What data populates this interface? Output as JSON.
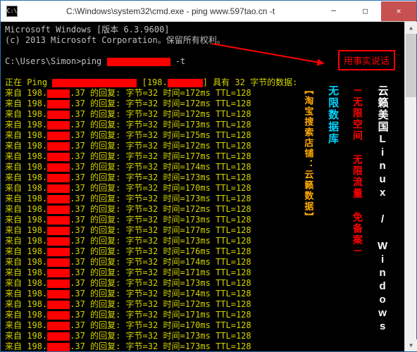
{
  "titlebar": {
    "icon_label": "C:\\",
    "title": "C:\\Windows\\system32\\cmd.exe - ping  www.597tao.cn -t",
    "min": "─",
    "max": "□",
    "close": "✕"
  },
  "terminal": {
    "header1": "Microsoft Windows [版本 6.3.9600]",
    "header2": "(c) 2013 Microsoft Corporation。保留所有权利。",
    "prompt_prefix": "C:\\Users\\Simon>ping ",
    "prompt_suffix": " -t",
    "pinging_prefix": "正在 Ping ",
    "pinging_ip_prefix": "[198.",
    "pinging_suffix": "] 具有 32 字节的数据:",
    "line_prefix": "来自",
    "line_ip_a": "198.",
    "line_ip_b": ".37",
    "line_reply": "的回复:",
    "line_bytes": "字节=32",
    "line_time_label": "时间=",
    "line_ttl": "TTL=128",
    "times": [
      "172ms",
      "172ms",
      "172ms",
      "173ms",
      "175ms",
      "172ms",
      "177ms",
      "174ms",
      "173ms",
      "170ms",
      "173ms",
      "172ms",
      "173ms",
      "177ms",
      "173ms",
      "176ms",
      "174ms",
      "171ms",
      "173ms",
      "174ms",
      "172ms",
      "171ms",
      "170ms",
      "173ms",
      "173ms"
    ]
  },
  "annotation": {
    "label": "用事实说话"
  },
  "banner": {
    "col1": "云籁美国Linux / Windows",
    "col2": "－无限空间 无限流量 免备案－",
    "col3": "无限数据库",
    "col4": "【淘宝搜索店铺：云籁数据】"
  },
  "scroll": {
    "up": "▲",
    "down": "▼"
  }
}
